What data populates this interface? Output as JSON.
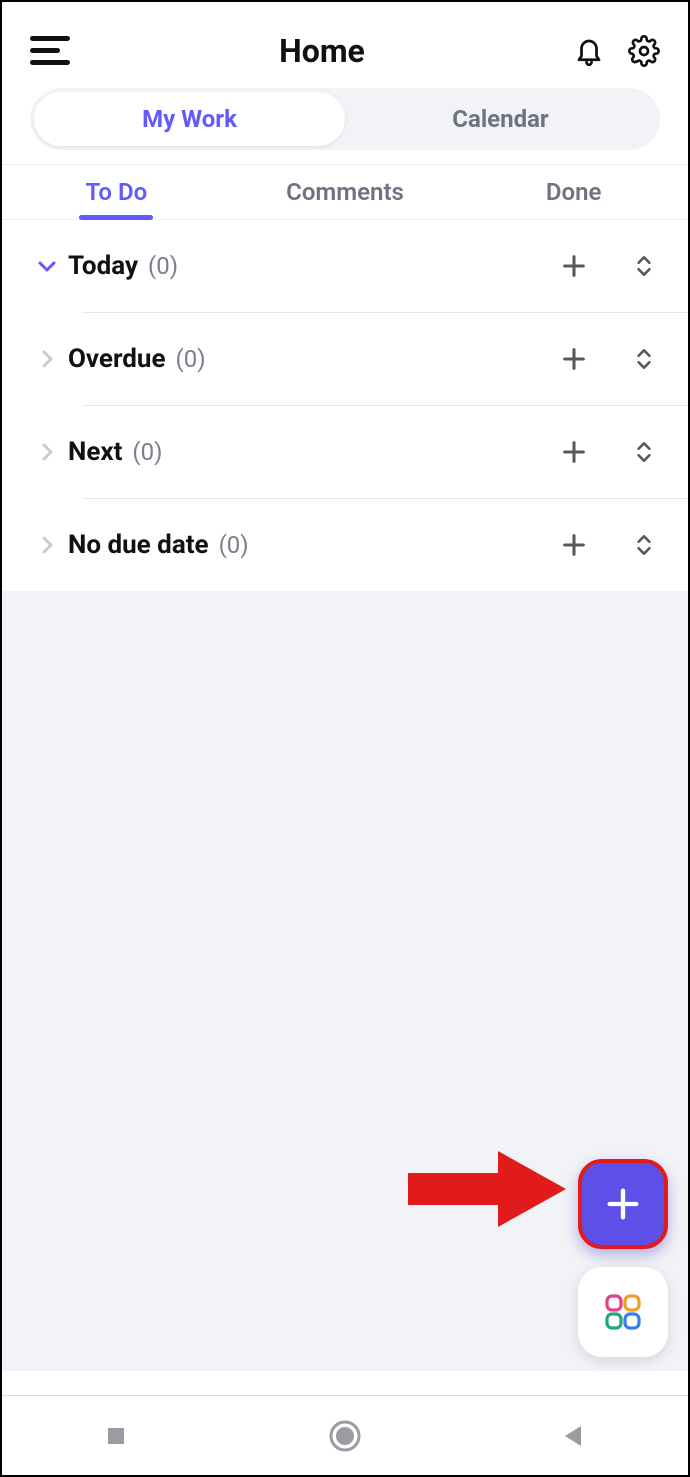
{
  "header": {
    "title": "Home"
  },
  "segmented": {
    "my_work": "My Work",
    "calendar": "Calendar",
    "active": "my_work"
  },
  "tabs": {
    "todo": "To Do",
    "comments": "Comments",
    "done": "Done",
    "active": "todo"
  },
  "sections": [
    {
      "label": "Today",
      "count": "(0)",
      "expanded": true
    },
    {
      "label": "Overdue",
      "count": "(0)",
      "expanded": false
    },
    {
      "label": "Next",
      "count": "(0)",
      "expanded": false
    },
    {
      "label": "No due date",
      "count": "(0)",
      "expanded": false
    }
  ],
  "colors": {
    "accent": "#6259ff",
    "fab": "#5c50e8",
    "highlight_border": "#e11b1b"
  }
}
